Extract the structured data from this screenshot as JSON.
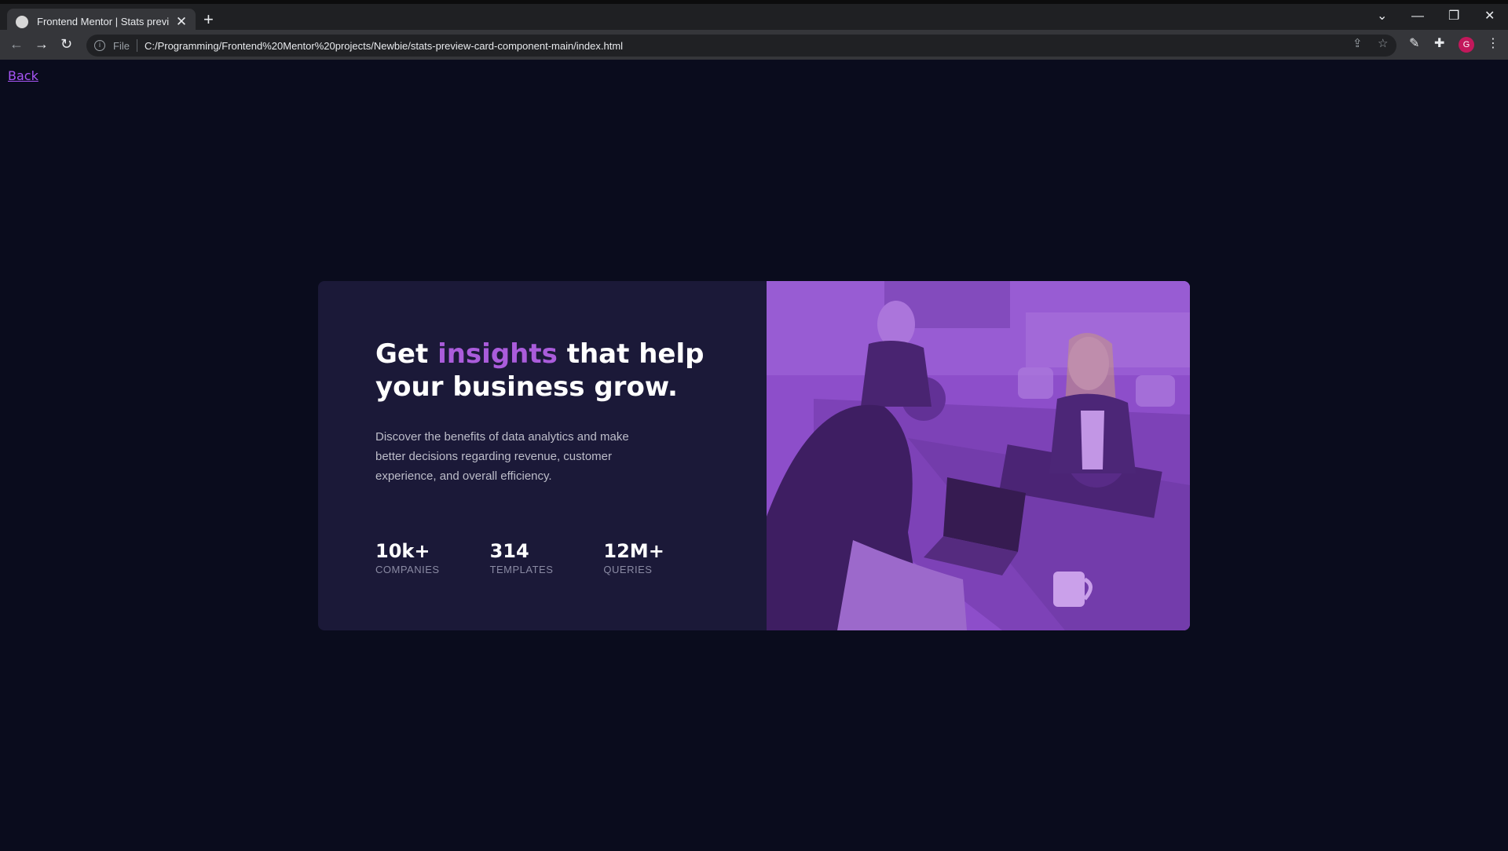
{
  "browser": {
    "tab_title": "Frontend Mentor | Stats preview",
    "tab_close": "✕",
    "new_tab": "+",
    "scheme": "File",
    "url": "C:/Programming/Frontend%20Mentor%20projects/Newbie/stats-preview-card-component-main/index.html",
    "profile_initial": "G"
  },
  "page": {
    "back_label": "Back"
  },
  "card": {
    "headline_pre": "Get ",
    "headline_accent": "insights",
    "headline_post": " that help your business grow.",
    "description": "Discover the benefits of data analytics and make better decisions regarding revenue, customer experience, and overall efficiency.",
    "stats": [
      {
        "value": "10k+",
        "label": "COMPANIES"
      },
      {
        "value": "314",
        "label": "TEMPLATES"
      },
      {
        "value": "12M+",
        "label": "QUERIES"
      }
    ]
  },
  "colors": {
    "page_bg": "#0a0c1d",
    "card_bg": "#1b1938",
    "accent": "#aa5cdb",
    "image_overlay": "#8d4bc9"
  }
}
